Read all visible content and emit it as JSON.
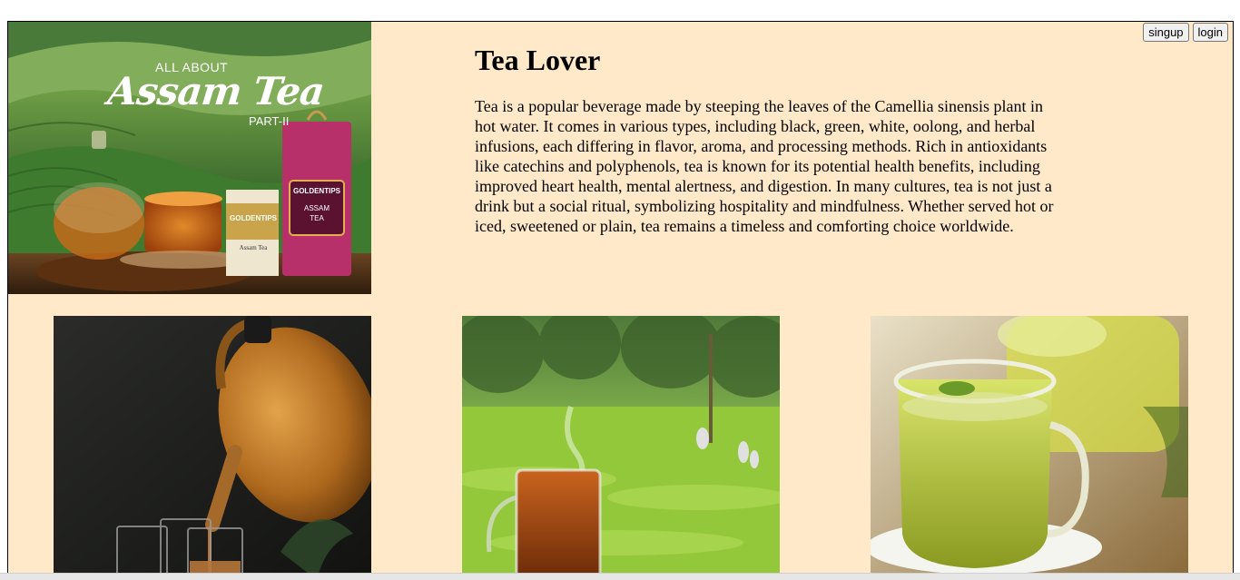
{
  "header": {
    "signup_label": "singup",
    "login_label": "login"
  },
  "hero": {
    "line1": "ALL ABOUT",
    "line2": "Assam Tea",
    "line3": "PART-II",
    "box_brand": "GOLDENTIPS",
    "box_label": "ASSAM TEA",
    "tin_brand": "GOLDENTIPS",
    "tin_label": "Assam Tea"
  },
  "main": {
    "title": "Tea Lover",
    "description": "Tea is a popular beverage made by steeping the leaves of the Camellia sinensis plant in hot water. It comes in various types, including black, green, white, oolong, and herbal infusions, each differing in flavor, aroma, and processing methods. Rich in antioxidants like catechins and polyphenols, tea is known for its potential health benefits, including improved heart health, mental alertness, and digestion. In many cultures, tea is not just a drink but a social ritual, symbolizing hospitality and mindfulness. Whether served hot or iced, sweetened or plain, tea remains a timeless and comforting choice worldwide."
  },
  "colors": {
    "page_background": "#ffe9c9",
    "border": "#000000"
  }
}
